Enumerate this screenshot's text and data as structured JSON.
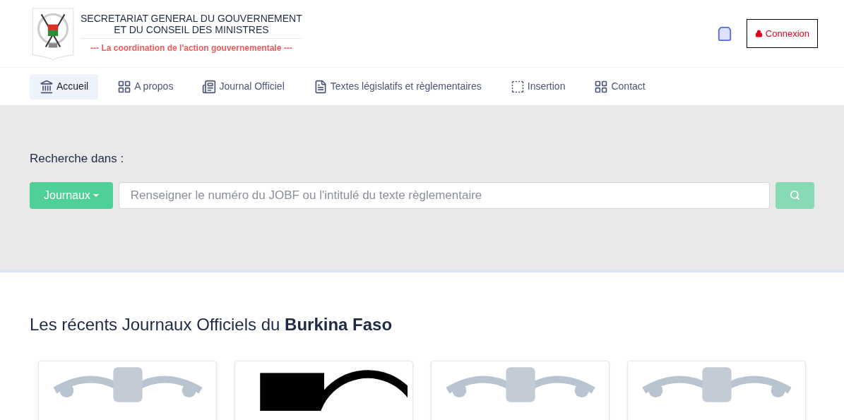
{
  "header": {
    "title_line_1": "SECRETARIAT GENERAL DU GOUVERNEMENT",
    "title_line_2": "ET DU CONSEIL DES MINISTRES",
    "tagline": "--- La coordination de l'action gouvernementale ---",
    "login_button": "Connexion"
  },
  "nav": [
    {
      "label": "Accueil",
      "kind": "bank",
      "selected": true
    },
    {
      "label": "A propos",
      "kind": "grid",
      "selected": false
    },
    {
      "label": "Journal Officiel",
      "kind": "journal",
      "selected": false
    },
    {
      "label": "Textes législatifs et règlementaires",
      "kind": "document",
      "selected": false
    },
    {
      "label": "Insertion",
      "kind": "frame",
      "selected": false
    },
    {
      "label": "Contact",
      "kind": "grid",
      "selected": false
    }
  ],
  "search": {
    "label": "Recherche dans :",
    "dropdown": "Journaux",
    "placeholder": "Renseigner le numéro du JOBF ou l'intitulé du texte règlementaire"
  },
  "recent": {
    "heading": "Les récents Journaux Officiels du **Burkina Faso**",
    "cards": [
      {
        "kind": "emblem"
      },
      {
        "kind": "journal"
      },
      {
        "kind": "emblem"
      },
      {
        "kind": "emblem"
      }
    ]
  }
}
